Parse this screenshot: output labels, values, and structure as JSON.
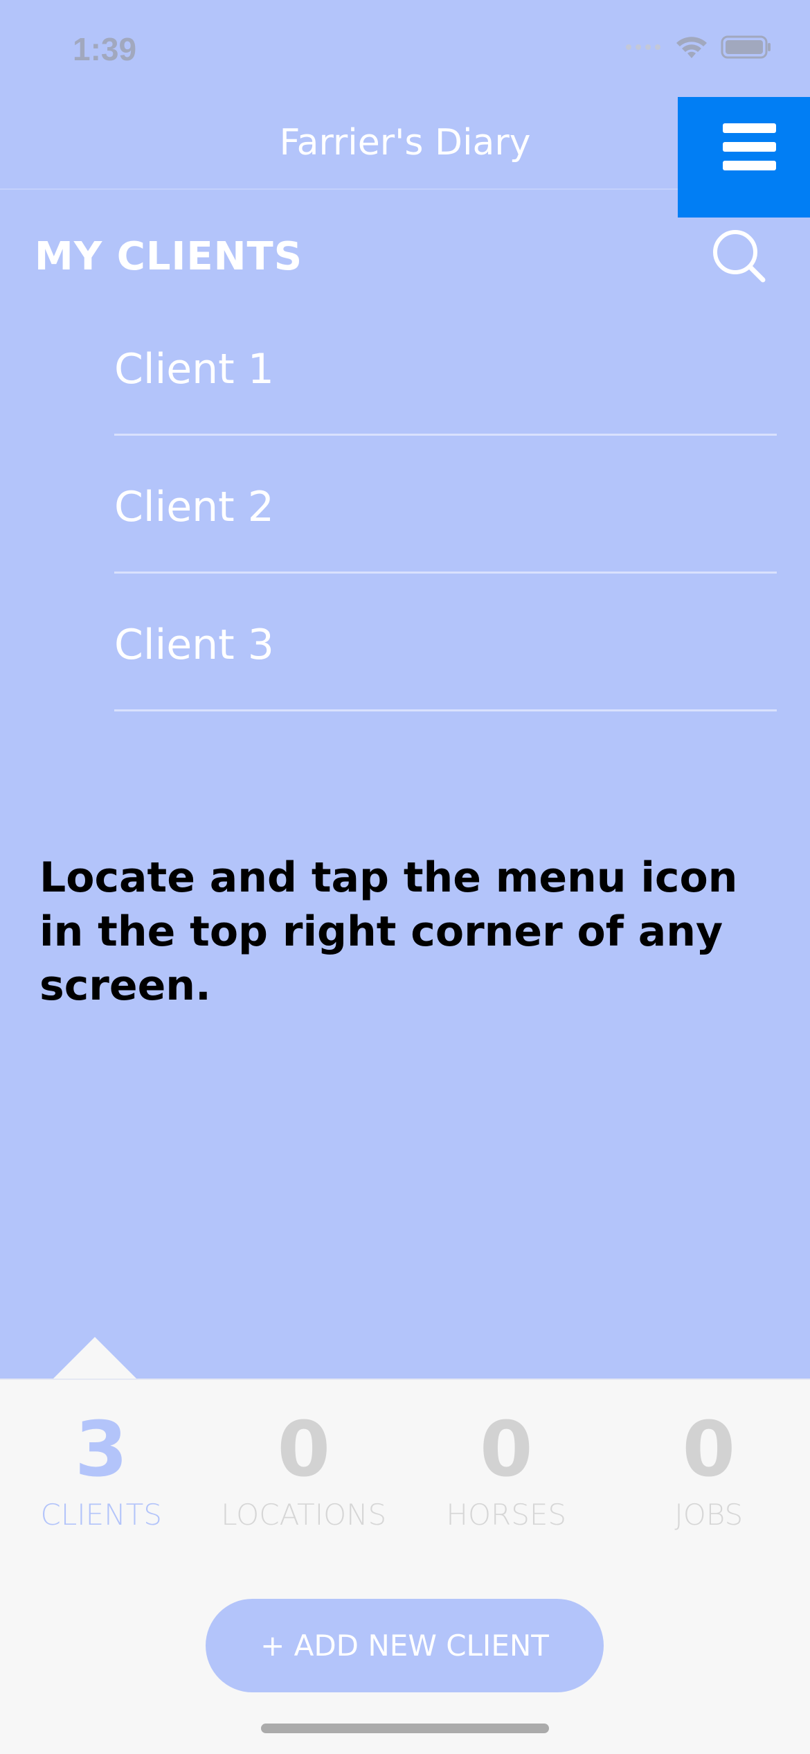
{
  "status_bar": {
    "time": "1:39",
    "icons": [
      "signal-icon",
      "wifi-icon",
      "battery-icon"
    ]
  },
  "nav": {
    "title": "Farrier's Diary",
    "menu_icon": "hamburger-menu-icon"
  },
  "section": {
    "title": "MY CLIENTS",
    "search_icon": "search-icon"
  },
  "clients": [
    {
      "name": "Client 1"
    },
    {
      "name": "Client 2"
    },
    {
      "name": "Client 3"
    }
  ],
  "instruction": "Locate and tap the menu icon in the top right corner of any screen.",
  "stats": [
    {
      "count": "3",
      "label": "CLIENTS",
      "active": true
    },
    {
      "count": "0",
      "label": "LOCATIONS",
      "active": false
    },
    {
      "count": "0",
      "label": "HORSES",
      "active": false
    },
    {
      "count": "0",
      "label": "JOBS",
      "active": false
    }
  ],
  "add_button": {
    "label": "+ ADD NEW CLIENT"
  },
  "colors": {
    "background": "#b3c4fa",
    "menu_button": "#017ef4",
    "panel": "#f7f7f7",
    "inactive_stat": "#d2d2d2"
  }
}
